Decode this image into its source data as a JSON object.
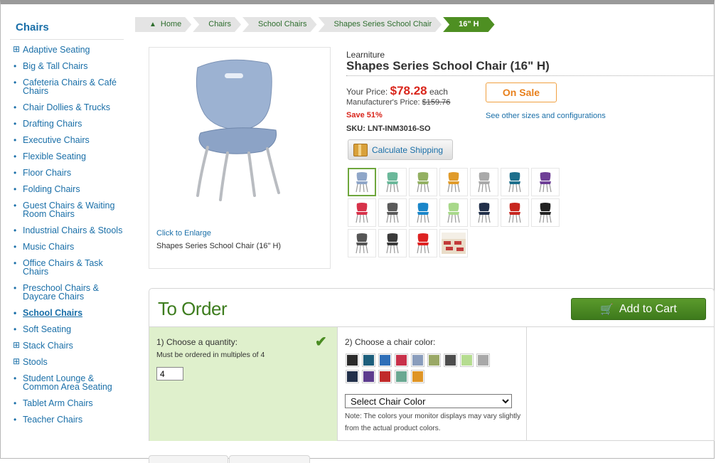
{
  "sidebar": {
    "title": "Chairs",
    "items": [
      {
        "label": "Adaptive Seating",
        "marker": "⊞"
      },
      {
        "label": "Big & Tall Chairs",
        "marker": "•"
      },
      {
        "label": "Cafeteria Chairs & Café Chairs",
        "marker": "•"
      },
      {
        "label": "Chair Dollies & Trucks",
        "marker": "•"
      },
      {
        "label": "Drafting Chairs",
        "marker": "•"
      },
      {
        "label": "Executive Chairs",
        "marker": "•"
      },
      {
        "label": "Flexible Seating",
        "marker": "•"
      },
      {
        "label": "Floor Chairs",
        "marker": "•"
      },
      {
        "label": "Folding Chairs",
        "marker": "•"
      },
      {
        "label": "Guest Chairs & Waiting Room Chairs",
        "marker": "•"
      },
      {
        "label": "Industrial Chairs & Stools",
        "marker": "•"
      },
      {
        "label": "Music Chairs",
        "marker": "•"
      },
      {
        "label": "Office Chairs & Task Chairs",
        "marker": "•"
      },
      {
        "label": "Preschool Chairs & Daycare Chairs",
        "marker": "•"
      },
      {
        "label": "School Chairs",
        "marker": "•"
      },
      {
        "label": "Soft Seating",
        "marker": "•"
      },
      {
        "label": "Stack Chairs",
        "marker": "⊞"
      },
      {
        "label": "Stools",
        "marker": "⊞"
      },
      {
        "label": "Student Lounge & Common Area Seating",
        "marker": "•"
      },
      {
        "label": "Tablet Arm Chairs",
        "marker": "•"
      },
      {
        "label": "Teacher Chairs",
        "marker": "•"
      }
    ]
  },
  "breadcrumb": {
    "items": [
      "Home",
      "Chairs",
      "School Chairs",
      "Shapes Series School Chair",
      "16\" H"
    ]
  },
  "product": {
    "brand": "Learniture",
    "title": "Shapes Series School Chair (16\" H)",
    "your_price_label": "Your Price:",
    "price": "$78.28",
    "price_unit": "each",
    "mfr_label": "Manufacturer's Price:",
    "mfr_price": "$159.76",
    "save": "Save 51%",
    "sku": "SKU: LNT-INM3016-SO",
    "on_sale": "On Sale",
    "other_sizes": "See other sizes and configurations",
    "calc_shipping": "Calculate Shipping",
    "click_to_enlarge": "Click to Enlarge",
    "image_caption": "Shapes Series School Chair (16\" H)"
  },
  "thumbnails": [
    "#8fa6c8",
    "#6bb89a",
    "#93b062",
    "#e09b2b",
    "#a9a9a9",
    "#1e6f8c",
    "#6e3f96",
    "#d7324a",
    "#5a5a5a",
    "#1a86c9",
    "#a8d88a",
    "#22304a",
    "#c7261f",
    "#222222",
    "#555555",
    "#3a3a3a",
    "#dd2222",
    "#classroom"
  ],
  "order": {
    "title": "To Order",
    "add_to_cart": "Add to Cart",
    "step1": "1) Choose a quantity:",
    "step1_note": "Must be ordered in multiples of 4",
    "quantity": "4",
    "step2": "2) Choose a chair color:",
    "select_label": "Select Chair Color",
    "color_note": "Note: The colors your monitor displays may vary slightly from the actual product colors.",
    "swatches": [
      "#2b2b2b",
      "#1d5f7c",
      "#2f6fb8",
      "#c8314a",
      "#8a9dbc",
      "#9aa866",
      "#4d4d4d",
      "#b5dc90",
      "#a8a8a8",
      "#22304a",
      "#5d3d8e",
      "#c02a2a",
      "#6aa892",
      "#df9526"
    ]
  }
}
